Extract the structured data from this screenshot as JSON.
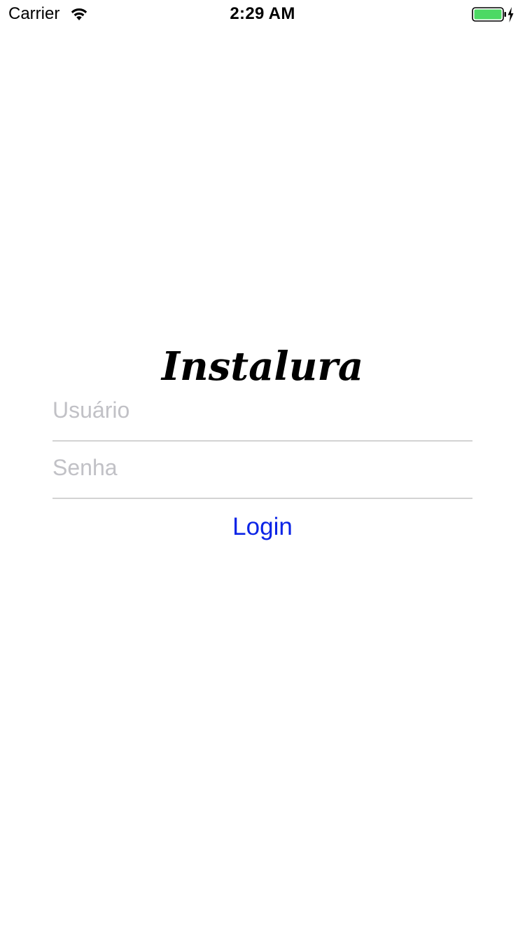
{
  "status_bar": {
    "carrier": "Carrier",
    "time": "2:29 AM",
    "icons": [
      "wifi-icon",
      "battery-icon",
      "charging-bolt-icon"
    ],
    "battery_color": "#4cd964"
  },
  "app": {
    "logo_text": "Instalura"
  },
  "login_form": {
    "username_placeholder": "Usuário",
    "username_value": "",
    "password_placeholder": "Senha",
    "password_value": "",
    "login_label": "Login",
    "accent_color": "#0b24e6"
  }
}
